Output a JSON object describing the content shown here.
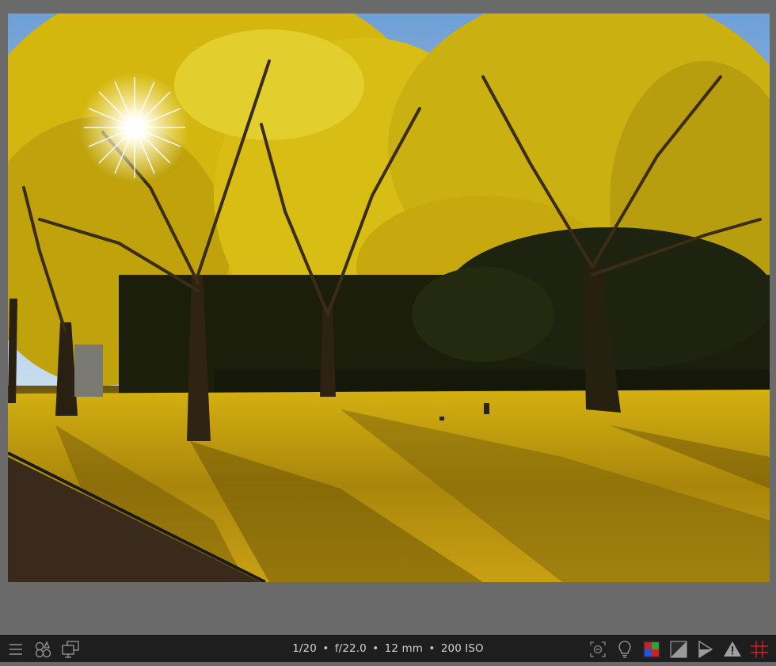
{
  "exif": {
    "shutter": "1/20",
    "aperture": "f/22.0",
    "focal_length": "12 mm",
    "iso": "200 ISO"
  },
  "toolbar": {
    "left_icons": [
      "hamburger-menu-icon",
      "styles-icon",
      "second-display-icon"
    ],
    "right_icons": [
      "focus-peaking-icon",
      "color-assessment-icon",
      "softproof-icon",
      "gamut-check-icon",
      "raw-overexposed-icon",
      "clipping-warning-icon",
      "guides-icon"
    ]
  },
  "colors": {
    "background": "#6a6a6a",
    "toolbar": "#1e1e1e",
    "text": "#d2d2d2"
  }
}
